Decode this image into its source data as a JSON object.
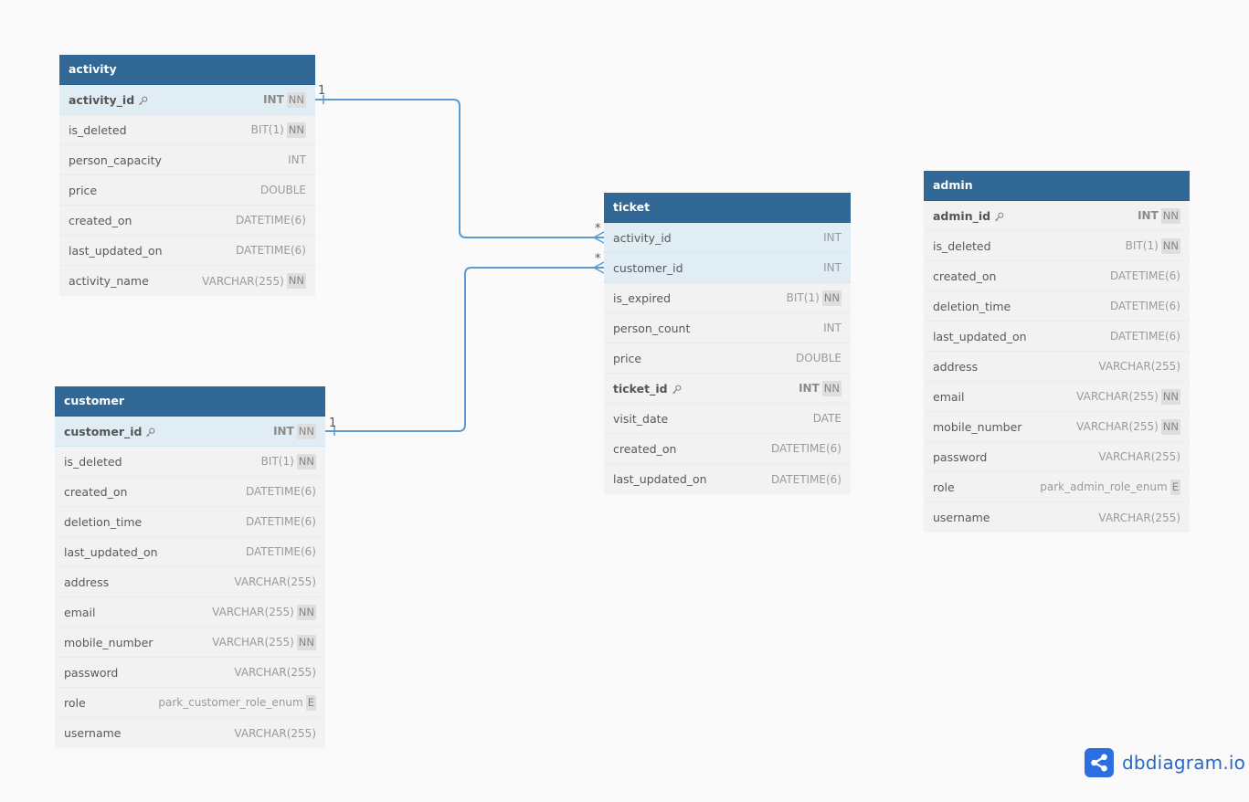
{
  "tables": {
    "activity": {
      "name": "activity",
      "columns": [
        {
          "name": "activity_id",
          "type": "INT",
          "badge": "NN",
          "pk": true,
          "highlight": true
        },
        {
          "name": "is_deleted",
          "type": "BIT(1)",
          "badge": "NN"
        },
        {
          "name": "person_capacity",
          "type": "INT",
          "badge": ""
        },
        {
          "name": "price",
          "type": "DOUBLE",
          "badge": ""
        },
        {
          "name": "created_on",
          "type": "DATETIME(6)",
          "badge": ""
        },
        {
          "name": "last_updated_on",
          "type": "DATETIME(6)",
          "badge": ""
        },
        {
          "name": "activity_name",
          "type": "VARCHAR(255)",
          "badge": "NN"
        }
      ]
    },
    "ticket": {
      "name": "ticket",
      "columns": [
        {
          "name": "activity_id",
          "type": "INT",
          "badge": "",
          "highlight": true
        },
        {
          "name": "customer_id",
          "type": "INT",
          "badge": "",
          "highlight": true
        },
        {
          "name": "is_expired",
          "type": "BIT(1)",
          "badge": "NN"
        },
        {
          "name": "person_count",
          "type": "INT",
          "badge": ""
        },
        {
          "name": "price",
          "type": "DOUBLE",
          "badge": ""
        },
        {
          "name": "ticket_id",
          "type": "INT",
          "badge": "NN",
          "pk": true
        },
        {
          "name": "visit_date",
          "type": "DATE",
          "badge": ""
        },
        {
          "name": "created_on",
          "type": "DATETIME(6)",
          "badge": ""
        },
        {
          "name": "last_updated_on",
          "type": "DATETIME(6)",
          "badge": ""
        }
      ]
    },
    "admin": {
      "name": "admin",
      "columns": [
        {
          "name": "admin_id",
          "type": "INT",
          "badge": "NN",
          "pk": true
        },
        {
          "name": "is_deleted",
          "type": "BIT(1)",
          "badge": "NN"
        },
        {
          "name": "created_on",
          "type": "DATETIME(6)",
          "badge": ""
        },
        {
          "name": "deletion_time",
          "type": "DATETIME(6)",
          "badge": ""
        },
        {
          "name": "last_updated_on",
          "type": "DATETIME(6)",
          "badge": ""
        },
        {
          "name": "address",
          "type": "VARCHAR(255)",
          "badge": ""
        },
        {
          "name": "email",
          "type": "VARCHAR(255)",
          "badge": "NN"
        },
        {
          "name": "mobile_number",
          "type": "VARCHAR(255)",
          "badge": "NN"
        },
        {
          "name": "password",
          "type": "VARCHAR(255)",
          "badge": ""
        },
        {
          "name": "role",
          "type": "park_admin_role_enum",
          "badge": "E"
        },
        {
          "name": "username",
          "type": "VARCHAR(255)",
          "badge": ""
        }
      ]
    },
    "customer": {
      "name": "customer",
      "columns": [
        {
          "name": "customer_id",
          "type": "INT",
          "badge": "NN",
          "pk": true,
          "highlight": true
        },
        {
          "name": "is_deleted",
          "type": "BIT(1)",
          "badge": "NN"
        },
        {
          "name": "created_on",
          "type": "DATETIME(6)",
          "badge": ""
        },
        {
          "name": "deletion_time",
          "type": "DATETIME(6)",
          "badge": ""
        },
        {
          "name": "last_updated_on",
          "type": "DATETIME(6)",
          "badge": ""
        },
        {
          "name": "address",
          "type": "VARCHAR(255)",
          "badge": ""
        },
        {
          "name": "email",
          "type": "VARCHAR(255)",
          "badge": "NN"
        },
        {
          "name": "mobile_number",
          "type": "VARCHAR(255)",
          "badge": "NN"
        },
        {
          "name": "password",
          "type": "VARCHAR(255)",
          "badge": ""
        },
        {
          "name": "role",
          "type": "park_customer_role_enum",
          "badge": "E"
        },
        {
          "name": "username",
          "type": "VARCHAR(255)",
          "badge": ""
        }
      ]
    }
  },
  "relationships": [
    {
      "from": "activity.activity_id",
      "to": "ticket.activity_id",
      "from_cardinality": "1",
      "to_cardinality": "*"
    },
    {
      "from": "customer.customer_id",
      "to": "ticket.customer_id",
      "from_cardinality": "1",
      "to_cardinality": "*"
    }
  ],
  "brand": {
    "name": "dbdiagram.io",
    "icon": "share-nodes-icon"
  },
  "colors": {
    "header": "#316896",
    "highlight_row": "#e0edf5",
    "row_bg": "#f2f2f2",
    "link": "#5b9bd1",
    "canvas": "#fafafa",
    "brand": "#2d6ee0"
  }
}
